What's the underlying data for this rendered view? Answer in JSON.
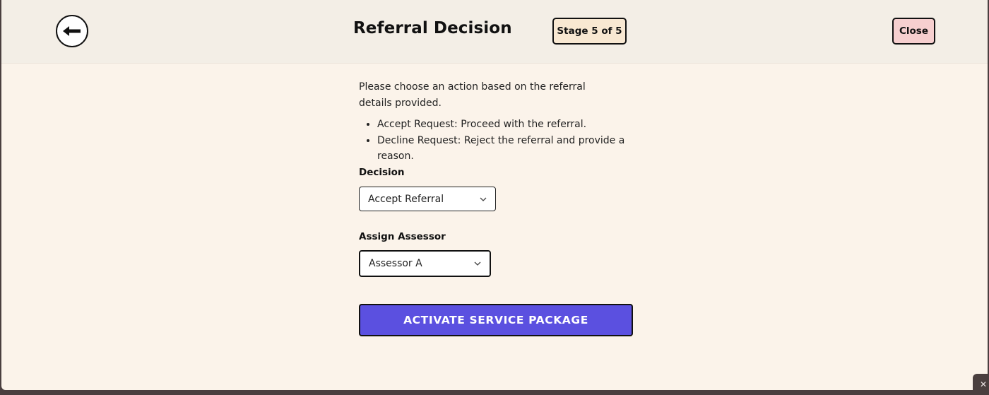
{
  "header": {
    "title": "Referral Decision",
    "stage_badge": "Stage 5 of 5",
    "close_label": "Close"
  },
  "instructions": {
    "intro": "Please choose an action based on the referral details provided.",
    "options": [
      "Accept Request: Proceed with the referral.",
      "Decline Request: Reject the referral and provide a reason."
    ]
  },
  "form": {
    "decision": {
      "label": "Decision",
      "value": "Accept Referral"
    },
    "assessor": {
      "label": "Assign Assessor",
      "value": "Assessor A"
    },
    "submit_label": "ACTIVATE SERVICE PACKAGE"
  },
  "icons": {
    "back": "arrow-left-icon",
    "dropdown": "chevron-down-icon",
    "corner": "close-icon"
  },
  "colors": {
    "primary_button": "#5b50e0",
    "close_button": "#f6cfcf",
    "stage_badge": "#f8e8d2",
    "background": "#fbf3ea",
    "header_background": "#f3eee6"
  }
}
